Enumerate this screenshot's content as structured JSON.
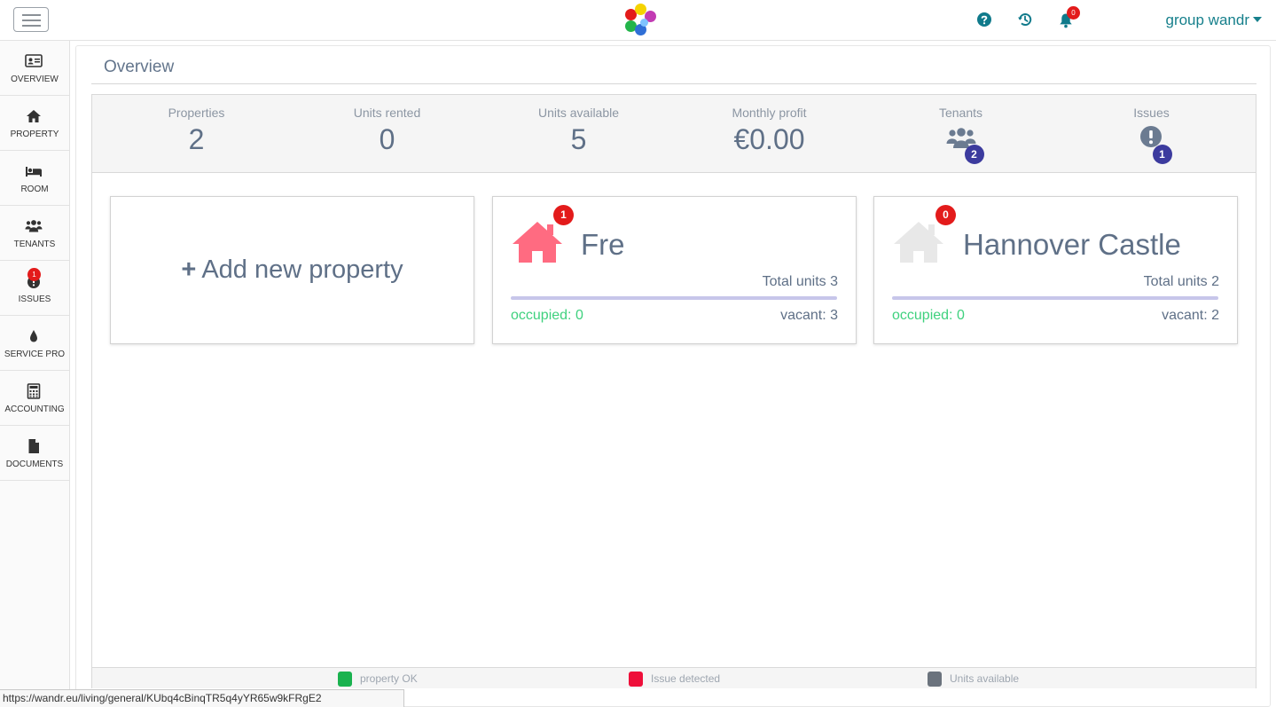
{
  "header": {
    "menu_icon": "hamburger-icon",
    "logo_colors": [
      "#e31b1b",
      "#f5d300",
      "#c23bb3",
      "#23b44a",
      "#2f6fd6",
      "#ffffff"
    ],
    "icons": [
      "question-circle-icon",
      "history-icon",
      "bell-icon"
    ],
    "notifications_count": "0",
    "user_label": "group wandr"
  },
  "sidebar": {
    "items": [
      {
        "label": "OVERVIEW",
        "icon": "id-card-icon"
      },
      {
        "label": "PROPERTY",
        "icon": "home-icon"
      },
      {
        "label": "ROOM",
        "icon": "bed-icon"
      },
      {
        "label": "TENANTS",
        "icon": "users-icon"
      },
      {
        "label": "ISSUES",
        "icon": "exclamation-circle-icon",
        "badge": "1"
      },
      {
        "label": "SERVICE PRO",
        "icon": "tint-icon"
      },
      {
        "label": "ACCOUNTING",
        "icon": "calculator-icon"
      },
      {
        "label": "DOCUMENTS",
        "icon": "file-icon"
      }
    ]
  },
  "main": {
    "title": "Overview",
    "stats": [
      {
        "label": "Properties",
        "value": "2"
      },
      {
        "label": "Units rented",
        "value": "0"
      },
      {
        "label": "Units available",
        "value": "5"
      },
      {
        "label": "Monthly profit",
        "value": "€0.00"
      },
      {
        "label": "Tenants",
        "icon": "users-icon",
        "badge": "2"
      },
      {
        "label": "Issues",
        "icon": "exclamation-circle-icon",
        "badge": "1"
      }
    ],
    "add_property": {
      "plus": "+",
      "label": "Add new property"
    },
    "properties": [
      {
        "name": "Fre",
        "issues_badge": "1",
        "total_units": "Total units 3",
        "occupied": "occupied: 0",
        "vacant": "vacant: 3",
        "house_color": "#ff6b81"
      },
      {
        "name": "Hannover Castle",
        "issues_badge": "0",
        "total_units": "Total units 2",
        "occupied": "occupied: 0",
        "vacant": "vacant: 2",
        "house_color": "#e8e8e8"
      }
    ],
    "legend": [
      {
        "label": "property OK",
        "color": "#1ab24f"
      },
      {
        "label": "Issue detected",
        "color": "#ee0f3a"
      },
      {
        "label": "Units available",
        "color": "#6b737d"
      }
    ]
  },
  "status_bar": {
    "url": "https://wandr.eu/living/general/KUbq4cBinqTR5q4yYR65w9kFRgE2"
  },
  "colors": {
    "accent": "#17808c",
    "badge_red": "#e31b1b",
    "badge_indigo": "#3c3b9e",
    "occupied_green": "#3fd17e",
    "text_slate": "#5f7087"
  }
}
